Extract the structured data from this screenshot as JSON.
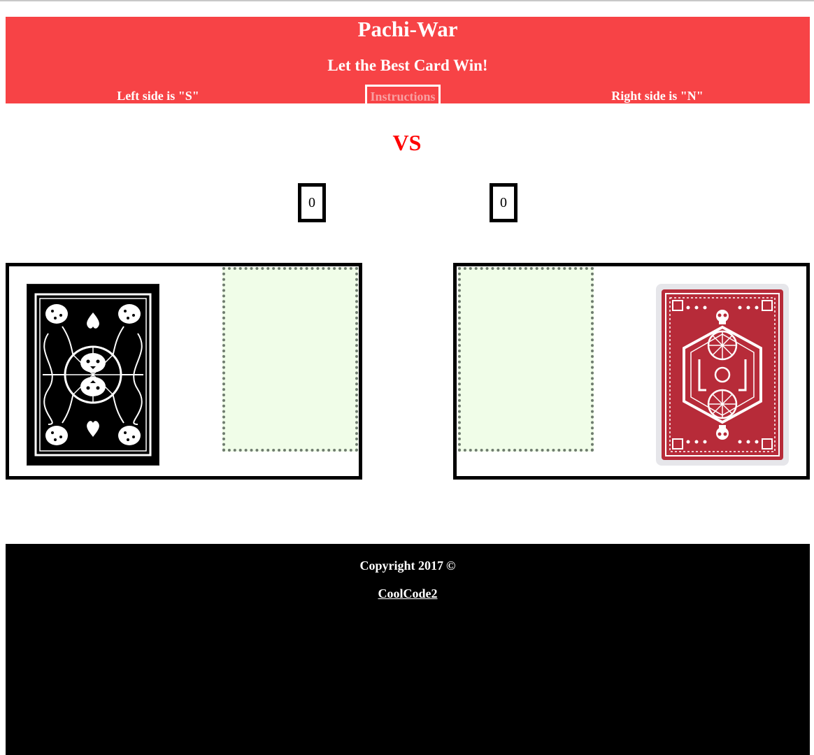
{
  "header": {
    "title": "Pachi-War",
    "subtitle": "Let the Best Card Win!",
    "left_label": "Left side is \"S\"",
    "instructions_label": "Instructions",
    "right_label": "Right side is \"N\""
  },
  "vs_label": "VS",
  "scores": {
    "left": "0",
    "right": "0"
  },
  "decks": {
    "left": {
      "style": "black-white-cheetah-card-back"
    },
    "right": {
      "style": "red-skull-card-back"
    }
  },
  "footer": {
    "copyright": "Copyright 2017",
    "copyright_symbol": "©",
    "link_text": "CoolCode2"
  },
  "colors": {
    "header_bg": "#f74346",
    "vs": "#ff0000",
    "dropzone_bg": "#f0fde8",
    "dropzone_border": "#6f7c6f",
    "footer_bg": "#000000",
    "card_red": "#b72b39"
  }
}
